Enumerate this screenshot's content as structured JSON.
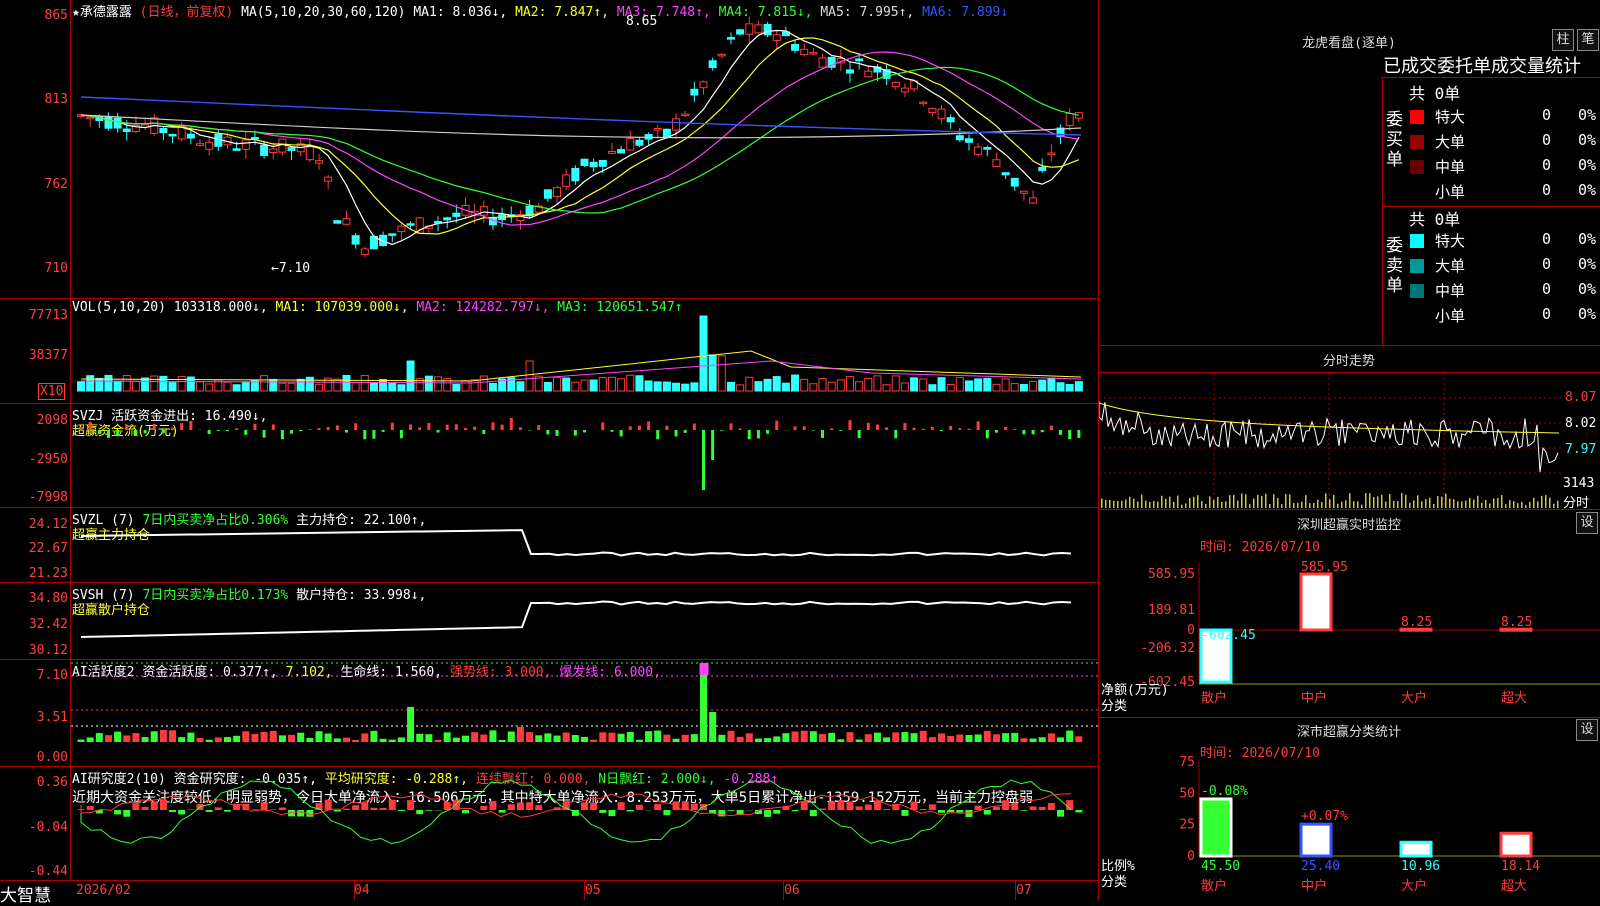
{
  "stock": {
    "title": "★承德露露",
    "mode": "(日线，前复权)",
    "ma_header": "MA(5,10,20,30,60,120)",
    "ma": [
      {
        "label": "MA1: 8.036↓,",
        "color": "#ffffff"
      },
      {
        "label": "MA2: 7.847↑,",
        "color": "#ffff33"
      },
      {
        "label": "MA3: 7.748↑,",
        "color": "#ff44ff"
      },
      {
        "label": "MA4: 7.815↓,",
        "color": "#33ff33"
      },
      {
        "label": "MA5: 7.995↑,",
        "color": "#dddddd"
      },
      {
        "label": "MA6: 7.899↓",
        "color": "#3355ff"
      }
    ],
    "high_mark": "8.65",
    "low_mark": "←7.10",
    "price_axis": [
      "865",
      "813",
      "762",
      "710"
    ]
  },
  "vol": {
    "header": "VOL(5,10,20)",
    "value": "103318.000↓,",
    "ma1": "MA1: 107039.000↓,",
    "ma2": "MA2: 124282.797↓,",
    "ma3": "MA3: 120651.547↑",
    "axis": [
      "77713",
      "38377"
    ],
    "unit": "X10"
  },
  "svzj": {
    "header": "SVZJ",
    "line1": "活跃资金进出: 16.490↓,",
    "line2": "超赢资金流(万元)",
    "axis": [
      "2098",
      "-2950",
      "-7998"
    ]
  },
  "svzl": {
    "header": "SVZL (7)",
    "text1": "7日内买卖净占比0.306%",
    "text2": "主力持仓: 22.100↑,",
    "line2": "超赢主力持仓",
    "axis": [
      "24.12",
      "22.67",
      "21.23"
    ]
  },
  "svsh": {
    "header": "SVSH (7)",
    "text1": "7日内买卖净占比0.173%",
    "text2": "散户持仓: 33.998↓,",
    "line2": "超赢散户持仓",
    "axis": [
      "34.80",
      "32.42",
      "30.12"
    ]
  },
  "ai1": {
    "header": "AI活跃度2",
    "t1": "资金活跃度: 0.377↑,",
    "t2": "7.102,",
    "t3": "生命线: 1.560,",
    "t4": "强势线: 3.000,",
    "t5": "爆发线: 6.000,",
    "axis": [
      "7.10",
      "3.51",
      "0.00"
    ]
  },
  "ai2": {
    "header": "AI研究度2(10)",
    "t1": "资金研究度: -0.035↑,",
    "t2": "平均研究度: -0.288↑,",
    "t3": "连续飘红: 0.000,",
    "t4": "N日飘红: 2.000↓,",
    "t5": "-0.288↑",
    "comment": "近期大资金关注度较低，明显弱势，今日大单净流入：16.506万元，其中特大单净流入：8.253万元，大单5日累计净出-1359.152万元，当前主力控盘弱",
    "axis": [
      "0.36",
      "-0.04",
      "-0.44"
    ]
  },
  "xaxis": {
    "brand": "大智慧",
    "labels": [
      "2026/02",
      "04",
      "05",
      "06",
      "07"
    ]
  },
  "right": {
    "dragon": {
      "title": "龙虎看盘(逐单)",
      "btn1": "柱",
      "btn2": "笔",
      "tabs": "已成交委托单成交量统计",
      "buy_label": "委买单",
      "sell_label": "委卖单",
      "buy_total": "共 0单",
      "sell_total": "共 0单",
      "rows": [
        {
          "name": "特大",
          "v": "0",
          "p": "0%"
        },
        {
          "name": "大单",
          "v": "0",
          "p": "0%"
        },
        {
          "name": "中单",
          "v": "0",
          "p": "0%"
        },
        {
          "name": "小单",
          "v": "0",
          "p": "0%"
        }
      ],
      "buy_colors": [
        "#ff0000",
        "#990000",
        "#660000"
      ],
      "sell_colors": [
        "#00ffff",
        "#009999",
        "#007777"
      ]
    },
    "intraday": {
      "title": "分时走势",
      "axis": [
        "8.07",
        "8.02",
        "7.97"
      ],
      "vol": "3143",
      "unit": "分时"
    },
    "monitor": {
      "title": "深圳超赢实时监控",
      "btn": "设",
      "time": "时间: 2026/07/10",
      "axis": [
        "585.95",
        "189.81",
        "0",
        "-206.32",
        "-602.45"
      ],
      "bars": [
        {
          "cat": "散户",
          "value": -602.45,
          "label": "-602.45"
        },
        {
          "cat": "中户",
          "value": 585.95,
          "label": "585.95"
        },
        {
          "cat": "大户",
          "value": 8.25,
          "label": "8.25"
        },
        {
          "cat": "超大",
          "value": 8.25,
          "label": "8.25"
        }
      ],
      "ylabel": "净额(万元)",
      "xlabel": "分类"
    },
    "classify": {
      "title": "深市超赢分类统计",
      "btn": "设",
      "time": "时间: 2026/07/10",
      "axis": [
        "75",
        "50",
        "25",
        "0"
      ],
      "bars": [
        {
          "cat": "散户",
          "value": 45.5,
          "label": "45.50",
          "change": "-0.08%"
        },
        {
          "cat": "中户",
          "value": 25.4,
          "label": "25.40",
          "change": "+0.07%"
        },
        {
          "cat": "大户",
          "value": 10.96,
          "label": "10.96",
          "change": ""
        },
        {
          "cat": "超大",
          "value": 18.14,
          "label": "18.14",
          "change": ""
        }
      ],
      "ylabel": "比例%",
      "xlabel": "分类"
    }
  }
}
